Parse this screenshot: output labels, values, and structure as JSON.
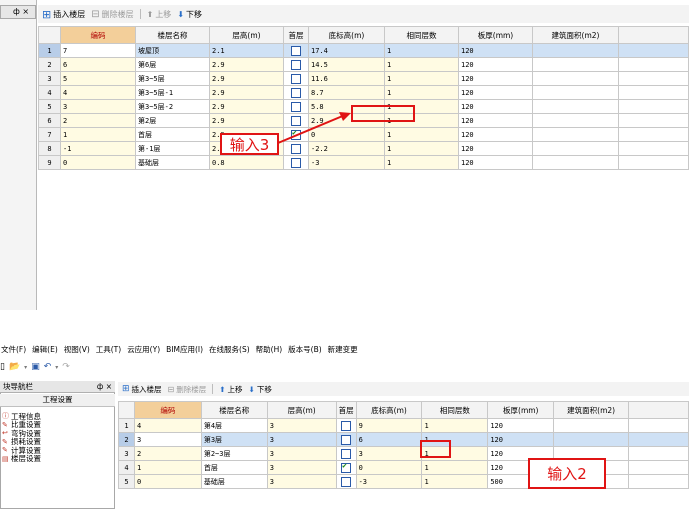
{
  "top": {
    "dock_label": "ф ×",
    "toolbar": {
      "insert": "插入楼层",
      "delete": "删除楼层",
      "up": "上移",
      "down": "下移"
    },
    "columns": [
      "编码",
      "楼层名称",
      "层高(m)",
      "首层",
      "底标高(m)",
      "相同层数",
      "板厚(mm)",
      "建筑面积(m2)"
    ],
    "rows": [
      {
        "n": "1",
        "code": "7",
        "name": "坡屋顶",
        "height": "2.1",
        "first": false,
        "base": "17.4",
        "same": "1",
        "slab": "120",
        "area": ""
      },
      {
        "n": "2",
        "code": "6",
        "name": "第6层",
        "height": "2.9",
        "first": false,
        "base": "14.5",
        "same": "1",
        "slab": "120",
        "area": ""
      },
      {
        "n": "3",
        "code": "5",
        "name": "第3~5层",
        "height": "2.9",
        "first": false,
        "base": "11.6",
        "same": "1",
        "slab": "120",
        "area": ""
      },
      {
        "n": "4",
        "code": "4",
        "name": "第3~5层-1",
        "height": "2.9",
        "first": false,
        "base": "8.7",
        "same": "1",
        "slab": "120",
        "area": ""
      },
      {
        "n": "5",
        "code": "3",
        "name": "第3~5层-2",
        "height": "2.9",
        "first": false,
        "base": "5.8",
        "same": "1",
        "slab": "120",
        "area": ""
      },
      {
        "n": "6",
        "code": "2",
        "name": "第2层",
        "height": "2.9",
        "first": false,
        "base": "2.9",
        "same": "1",
        "slab": "120",
        "area": ""
      },
      {
        "n": "7",
        "code": "1",
        "name": "首层",
        "height": "2.9",
        "first": true,
        "base": "0",
        "same": "1",
        "slab": "120",
        "area": ""
      },
      {
        "n": "8",
        "code": "-1",
        "name": "第-1层",
        "height": "2.2",
        "first": false,
        "base": "-2.2",
        "same": "1",
        "slab": "120",
        "area": ""
      },
      {
        "n": "9",
        "code": "0",
        "name": "基础层",
        "height": "0.8",
        "first": false,
        "base": "-3",
        "same": "1",
        "slab": "120",
        "area": ""
      }
    ],
    "callout": "输入3"
  },
  "menu": [
    "文件(F)",
    "编辑(E)",
    "视图(V)",
    "工具(T)",
    "云应用(Y)",
    "BIM应用(I)",
    "在线服务(S)",
    "帮助(H)",
    "版本号(B)",
    "新建变更"
  ],
  "nav": {
    "title": "块导航栏",
    "dock": "ф ×",
    "section": "工程设置",
    "items": [
      "工程信息",
      "比重设置",
      "弯钩设置",
      "损耗设置",
      "计算设置",
      "楼层设置"
    ]
  },
  "bottom": {
    "toolbar": {
      "insert": "插入楼层",
      "delete": "删除楼层",
      "up": "上移",
      "down": "下移"
    },
    "columns": [
      "编码",
      "楼层名称",
      "层高(m)",
      "首层",
      "底标高(m)",
      "相同层数",
      "板厚(mm)",
      "建筑面积(m2)"
    ],
    "rows": [
      {
        "n": "1",
        "code": "4",
        "name": "第4层",
        "height": "3",
        "first": false,
        "base": "9",
        "same": "1",
        "slab": "120",
        "area": ""
      },
      {
        "n": "2",
        "code": "3",
        "name": "第3层",
        "height": "3",
        "first": false,
        "base": "6",
        "same": "1",
        "slab": "120",
        "area": ""
      },
      {
        "n": "3",
        "code": "2",
        "name": "第2~3层",
        "height": "3",
        "first": false,
        "base": "3",
        "same": "1",
        "slab": "120",
        "area": ""
      },
      {
        "n": "4",
        "code": "1",
        "name": "首层",
        "height": "3",
        "first": true,
        "base": "0",
        "same": "1",
        "slab": "120",
        "area": ""
      },
      {
        "n": "5",
        "code": "0",
        "name": "基础层",
        "height": "3",
        "first": false,
        "base": "-3",
        "same": "1",
        "slab": "500",
        "area": ""
      }
    ],
    "callout": "输入2"
  },
  "colors": {
    "annotation_red": "#e01414",
    "selected_row": "#cfe1f5",
    "code_header": "#f3cf9a"
  }
}
